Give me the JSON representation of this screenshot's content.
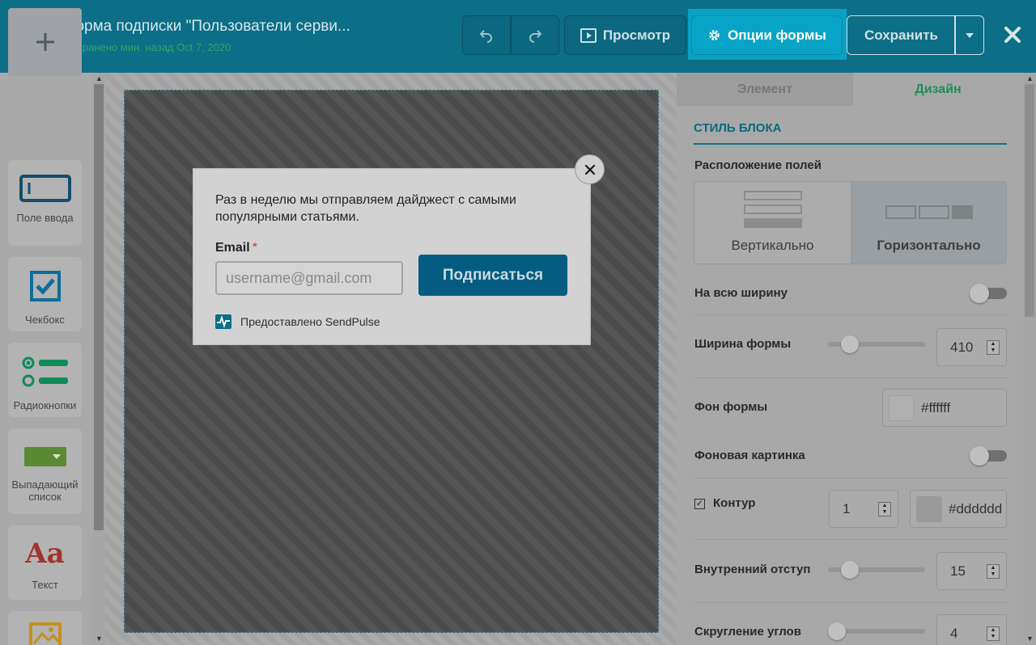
{
  "header": {
    "title": "Форма подписки \"Пользователи серви...",
    "saved_status": "Сохранено мин. назад Oct 7, 2020",
    "undo_icon": "undo-icon",
    "redo_icon": "redo-icon",
    "preview_label": "Просмотр",
    "options_label": "Опции формы",
    "save_label": "Сохранить",
    "close_icon": "close-icon"
  },
  "toolbox": {
    "add_icon": "plus-icon",
    "items": [
      {
        "label": "Поле ввода",
        "icon": "input-field-icon"
      },
      {
        "label": "Чекбокс",
        "icon": "checkbox-icon"
      },
      {
        "label": "Радиокнопки",
        "icon": "radio-buttons-icon"
      },
      {
        "label": "Выпадающий список",
        "icon": "dropdown-icon"
      },
      {
        "label": "Текст",
        "icon": "text-icon"
      },
      {
        "label": "",
        "icon": "image-icon"
      }
    ],
    "text_glyph": "Aa"
  },
  "form_preview": {
    "description": "Раз в неделю мы отправляем дайджест с самыми популярными статьями.",
    "email_label": "Email",
    "required_mark": "*",
    "email_placeholder": "username@gmail.com",
    "subscribe_label": "Подписаться",
    "powered_by": "Предоставлено SendPulse"
  },
  "panel": {
    "tabs": [
      {
        "label": "Элемент",
        "active": false
      },
      {
        "label": "Дизайн",
        "active": true
      }
    ],
    "section_title": "СТИЛЬ БЛОКА",
    "fields_layout": {
      "label": "Расположение полей",
      "options": [
        "Вертикально",
        "Горизонтально"
      ],
      "selected": "Горизонтально"
    },
    "full_width": {
      "label": "На всю ширину",
      "on": false
    },
    "form_width": {
      "label": "Ширина формы",
      "value": "410"
    },
    "form_bg": {
      "label": "Фон формы",
      "value": "#ffffff"
    },
    "bg_image": {
      "label": "Фоновая картинка",
      "on": false
    },
    "border": {
      "label": "Контур",
      "checked": true,
      "width": "1",
      "color": "#dddddd"
    },
    "padding": {
      "label": "Внутренний отступ",
      "value": "15"
    },
    "radius": {
      "label": "Скругление углов",
      "value": "4"
    }
  },
  "colors": {
    "header_bg": "#0c6e87",
    "accent": "#08a4c7",
    "subscribe_btn": "#055c82",
    "design_tab": "#1d8f58"
  }
}
